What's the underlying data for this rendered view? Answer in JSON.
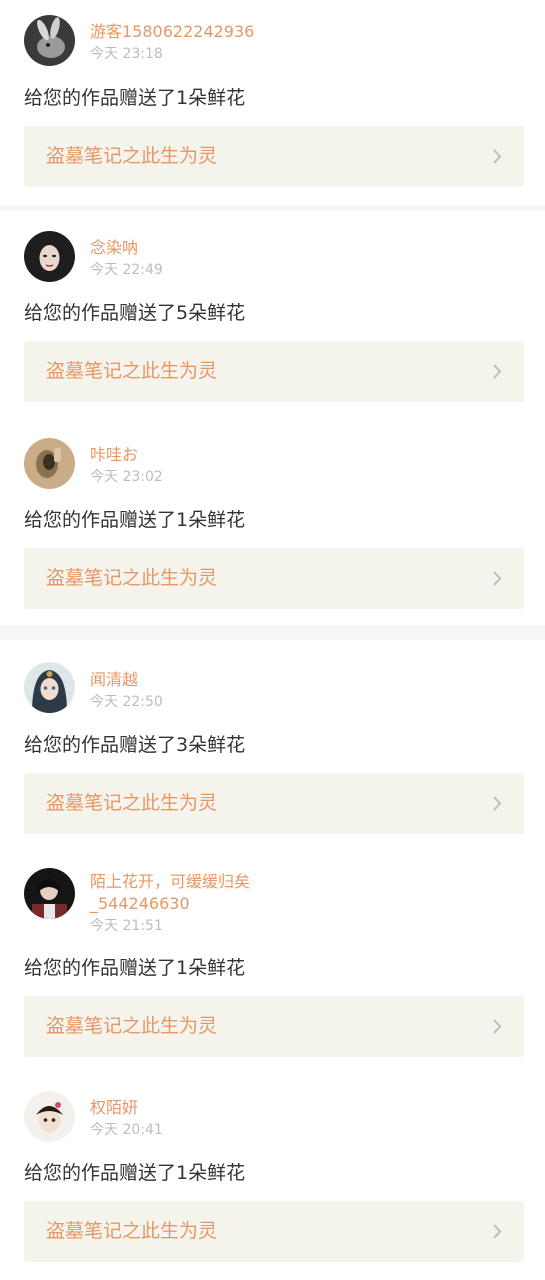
{
  "notifications": [
    {
      "username": "游客1580622242936",
      "time": "今天 23:18",
      "message": "给您的作品赠送了1朵鲜花",
      "work_title": "盗墓笔记之此生为灵",
      "avatar_icon": "rabbit-avatar-icon",
      "avatar_colors": [
        "#3a3a3a",
        "#d9d9d9"
      ]
    },
    {
      "username": "念染呐",
      "time": "今天 22:49",
      "message": "给您的作品赠送了5朵鲜花",
      "work_title": "盗墓笔记之此生为灵",
      "avatar_icon": "girl-avatar-icon",
      "avatar_colors": [
        "#1e1e1e",
        "#e8d8cc"
      ]
    },
    {
      "username": "咔哇お",
      "time": "今天 23:02",
      "message": "给您的作品赠送了1朵鲜花",
      "work_title": "盗墓笔记之此生为灵",
      "avatar_icon": "photo-avatar-icon",
      "avatar_colors": [
        "#8a7250",
        "#c9ad88"
      ]
    },
    {
      "username": "闻清越",
      "time": "今天 22:50",
      "message": "给您的作品赠送了3朵鲜花",
      "work_title": "盗墓笔记之此生为灵",
      "avatar_icon": "anime-girl-avatar-icon",
      "avatar_colors": [
        "#2d3a48",
        "#f1ddd0"
      ]
    },
    {
      "username": "陌上花开，可缓缓归矣",
      "username_line2": "_544246630",
      "time": "今天 21:51",
      "message": "给您的作品赠送了1朵鲜花",
      "work_title": "盗墓笔记之此生为灵",
      "avatar_icon": "dark-photo-avatar-icon",
      "avatar_colors": [
        "#151515",
        "#7a2a2a"
      ]
    },
    {
      "username": "权陌妍",
      "time": "今天 20:41",
      "message": "给您的作品赠送了1朵鲜花",
      "work_title": "盗墓笔记之此生为灵",
      "avatar_icon": "child-avatar-icon",
      "avatar_colors": [
        "#2a1a12",
        "#f3dfd2"
      ]
    }
  ],
  "colors": {
    "accent": "#e69766",
    "time": "#bdbdbd",
    "text": "#333333",
    "work_bg": "#f5f4ec",
    "page_bg": "#f6f6f6"
  }
}
